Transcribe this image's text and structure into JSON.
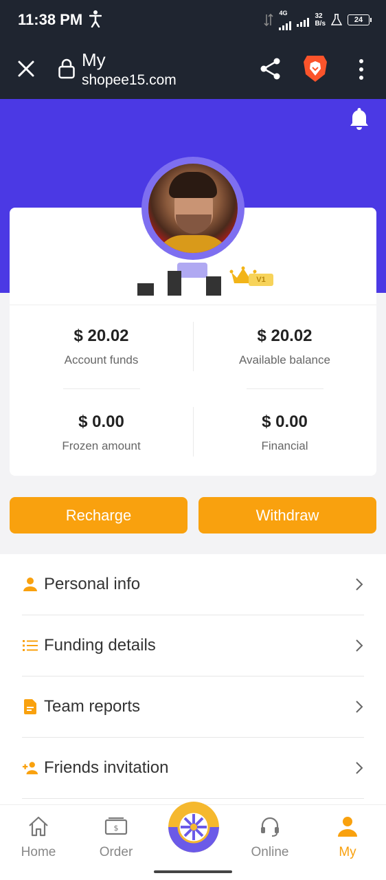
{
  "status_bar": {
    "time": "11:38 PM",
    "network": "4G",
    "speed_value": "32",
    "speed_unit": "B/s",
    "battery": "24"
  },
  "browser": {
    "title": "My",
    "domain": "shopee15.com"
  },
  "stats": [
    {
      "value": "$ 20.02",
      "label": "Account funds"
    },
    {
      "value": "$ 20.02",
      "label": "Available balance"
    },
    {
      "value": "$ 0.00",
      "label": "Frozen amount"
    },
    {
      "value": "$ 0.00",
      "label": "Financial"
    }
  ],
  "vip_badge": "V1",
  "actions": {
    "recharge": "Recharge",
    "withdraw": "Withdraw"
  },
  "menu": [
    {
      "label": "Personal info",
      "icon": "person-icon"
    },
    {
      "label": "Funding details",
      "icon": "list-icon"
    },
    {
      "label": "Team reports",
      "icon": "document-icon"
    },
    {
      "label": "Friends invitation",
      "icon": "add-person-icon"
    }
  ],
  "nav": {
    "home": "Home",
    "order": "Order",
    "online": "Online",
    "my": "My"
  },
  "colors": {
    "header": "#4b39e4",
    "accent": "#f9a10e",
    "status_bar": "#1f2530"
  }
}
